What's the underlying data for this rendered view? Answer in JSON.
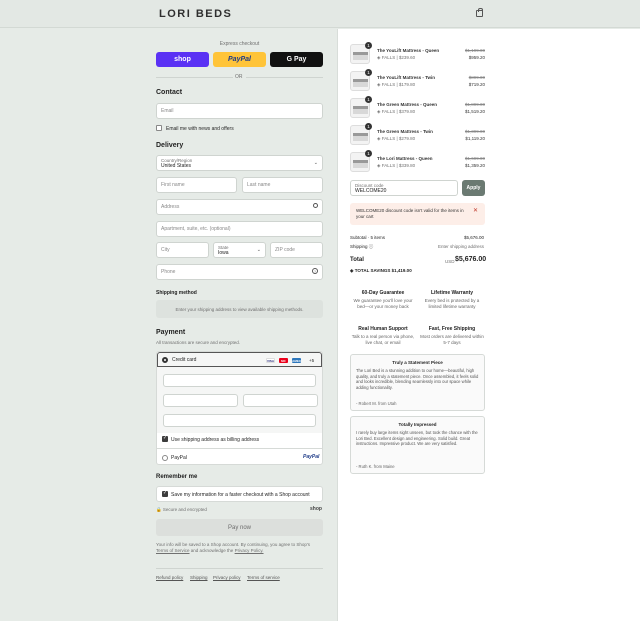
{
  "header": {
    "logo": "LORI BEDS",
    "cart_icon": "shopping-bag-icon"
  },
  "express": {
    "title": "Express checkout",
    "shop_label": "shop",
    "paypal_label": "PayPal",
    "gpay_label": "G Pay",
    "or_label": "OR"
  },
  "contact": {
    "heading": "Contact",
    "email_placeholder": "Email",
    "newsletter_label": "Email me with news and offers"
  },
  "delivery": {
    "heading": "Delivery",
    "country_label": "Country/Region",
    "country_value": "United States",
    "first_name_placeholder": "First name",
    "last_name_placeholder": "Last name",
    "address_placeholder": "Address",
    "apartment_placeholder": "Apartment, suite, etc. (optional)",
    "city_placeholder": "City",
    "state_label": "State",
    "state_value": "Iowa",
    "zip_placeholder": "ZIP code",
    "phone_placeholder": "Phone"
  },
  "shipping_method": {
    "heading": "Shipping method",
    "notice": "Enter your shipping address to view available shipping methods."
  },
  "payment": {
    "heading": "Payment",
    "subtitle": "All transactions are secure and encrypted.",
    "credit_card_label": "Credit card",
    "card_logos": [
      "VISA",
      "MC",
      "AMEX"
    ],
    "more_cards": "+5",
    "billing_label": "Use shipping address as billing address",
    "paypal_option": "PayPal",
    "paypal_logo": "PayPal"
  },
  "remember": {
    "heading": "Remember me",
    "save_label": "Save my information for a faster checkout with a Shop account",
    "secure_label": "Secure and encrypted",
    "shop_logo": "shop"
  },
  "pay_button": "Pay now",
  "legal": {
    "text": "Your info will be saved to a Shop account. By continuing, you agree to Shop's",
    "terms": "Terms of Service",
    "and": "and acknowledge the",
    "privacy": "Privacy Policy."
  },
  "footer_links": [
    "Refund policy",
    "Shipping",
    "Privacy policy",
    "Terms of service"
  ],
  "cart": {
    "items": [
      {
        "qty": "1",
        "name": "The YouLift Mattress - Queen",
        "note": "FALLS | $239.60",
        "old_price": "$1,199.00",
        "price": "$959.20"
      },
      {
        "qty": "1",
        "name": "The YouLift Mattress - Twin",
        "note": "FALLS | $179.80",
        "old_price": "$899.00",
        "price": "$719.20"
      },
      {
        "qty": "1",
        "name": "The Green Mattress - Queen",
        "note": "FALLS | $379.80",
        "old_price": "$1,899.00",
        "price": "$1,519.20"
      },
      {
        "qty": "1",
        "name": "The Green Mattress - Twin",
        "note": "FALLS | $279.80",
        "old_price": "$1,399.00",
        "price": "$1,119.20"
      },
      {
        "qty": "1",
        "name": "The Lori Mattress - Queen",
        "note": "FALLS | $339.80",
        "old_price": "$1,699.00",
        "price": "$1,359.20"
      }
    ],
    "discount_label": "Discount code",
    "discount_value": "WELCOME20",
    "apply_label": "Apply",
    "error_text": "WELCOME20 discount code isn't valid for the items in your cart",
    "subtotal_label": "Subtotal · 5 items",
    "subtotal_value": "$5,676.00",
    "shipping_label": "Shipping",
    "shipping_value": "Enter shipping address",
    "total_label": "Total",
    "currency": "USD",
    "total_value": "$5,676.00",
    "savings_label": "TOTAL SAVINGS",
    "savings_value": "$1,419.00"
  },
  "features": [
    {
      "title": "60-Day Guarantee",
      "desc": "We guarantee you'll love your bed—or your money back"
    },
    {
      "title": "Lifetime Warranty",
      "desc": "Every bed is protected by a limited lifetime warranty"
    },
    {
      "title": "Real Human Support",
      "desc": "Talk to a real person via phone, live chat, or email"
    },
    {
      "title": "Fast, Free Shipping",
      "desc": "Most orders are delivered within 5-7 days"
    }
  ],
  "reviews": [
    {
      "title": "Truly a Statement Piece",
      "body": "The Lori Bed is a stunning addition to our home—beautiful, high quality, and truly a statement piece. Once assembled, it feels solid and looks incredible, blending seamlessly into our space while adding functionality.",
      "author": "- Robert M. from Utah"
    },
    {
      "title": "Totally Impressed",
      "body": "I rarely buy large items sight unseen, but took the chance with the Lori Bed. Excellent design and engineering. Solid build. Great instructions. Impressive product. We are very satisfied.",
      "author": "- Ruth K. from Maine"
    }
  ]
}
